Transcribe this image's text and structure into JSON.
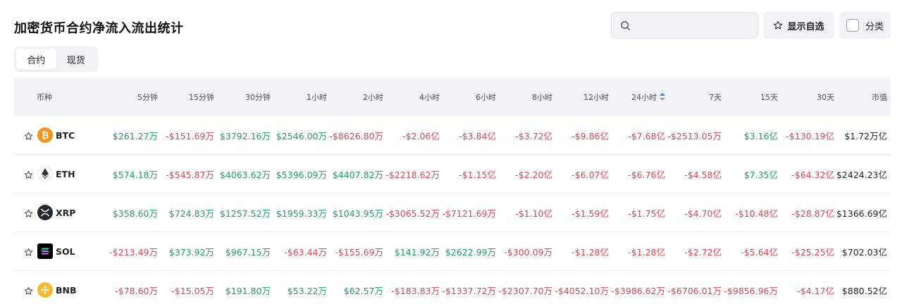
{
  "page": {
    "title": "加密货币合约净流入流出统计"
  },
  "search": {
    "placeholder": ""
  },
  "toolbar": {
    "favorites_label": "显示自选",
    "category_label": "分类"
  },
  "tabs": [
    {
      "label": "合约",
      "active": true
    },
    {
      "label": "现货",
      "active": false
    }
  ],
  "table": {
    "headers": [
      "币种",
      "5分钟",
      "15分钟",
      "30分钟",
      "1小时",
      "2小时",
      "4小时",
      "6小时",
      "8小时",
      "12小时",
      "24小时",
      "7天",
      "15天",
      "30天",
      "市值"
    ],
    "sorted_column": "24小时",
    "rows": [
      {
        "symbol": "BTC",
        "icon": "bitcoin-icon",
        "icon_color": "#f7931a",
        "values": [
          "$261.27万",
          "-$151.69万",
          "$3792.16万",
          "$2546.00万",
          "-$8626.80万",
          "-$2.06亿",
          "-$3.84亿",
          "-$3.72亿",
          "-$9.86亿",
          "-$7.68亿",
          "-$2513.05万",
          "$3.16亿",
          "-$130.19亿"
        ],
        "market_cap": "$1.72万亿"
      },
      {
        "symbol": "ETH",
        "icon": "ethereum-icon",
        "icon_color": "#ffffff",
        "values": [
          "$574.18万",
          "-$545.87万",
          "$4063.62万",
          "$5396.09万",
          "$4407.82万",
          "-$2218.62万",
          "-$1.15亿",
          "-$2.20亿",
          "-$6.07亿",
          "-$6.76亿",
          "-$4.58亿",
          "$7.35亿",
          "-$64.32亿"
        ],
        "market_cap": "$2424.23亿"
      },
      {
        "symbol": "XRP",
        "icon": "xrp-icon",
        "icon_color": "#23292f",
        "values": [
          "$358.60万",
          "$724.83万",
          "$1257.52万",
          "$1959.33万",
          "$1043.95万",
          "-$3065.52万",
          "-$7121.69万",
          "-$1.10亿",
          "-$1.59亿",
          "-$1.75亿",
          "-$4.70亿",
          "-$10.48亿",
          "-$28.87亿"
        ],
        "market_cap": "$1366.69亿"
      },
      {
        "symbol": "SOL",
        "icon": "solana-icon",
        "icon_color": "#000000",
        "values": [
          "-$213.49万",
          "$373.92万",
          "$967.15万",
          "-$63.44万",
          "-$155.69万",
          "$141.92万",
          "$2622.99万",
          "-$300.09万",
          "-$1.28亿",
          "-$1.28亿",
          "-$2.72亿",
          "-$5.64亿",
          "-$25.25亿"
        ],
        "market_cap": "$702.03亿"
      },
      {
        "symbol": "BNB",
        "icon": "bnb-icon",
        "icon_color": "#f3ba2f",
        "values": [
          "-$78.60万",
          "-$15.05万",
          "$191.80万",
          "$53.22万",
          "$62.57万",
          "-$183.83万",
          "-$1337.72万",
          "-$2307.70万",
          "-$4052.10万",
          "-$3986.62万",
          "-$6706.01万",
          "-$9856.96万",
          "-$4.17亿"
        ],
        "market_cap": "$880.52亿"
      }
    ]
  },
  "colors": {
    "positive": "#1aa36a",
    "negative": "#e8424f",
    "header_bg": "#f2f3f5"
  }
}
